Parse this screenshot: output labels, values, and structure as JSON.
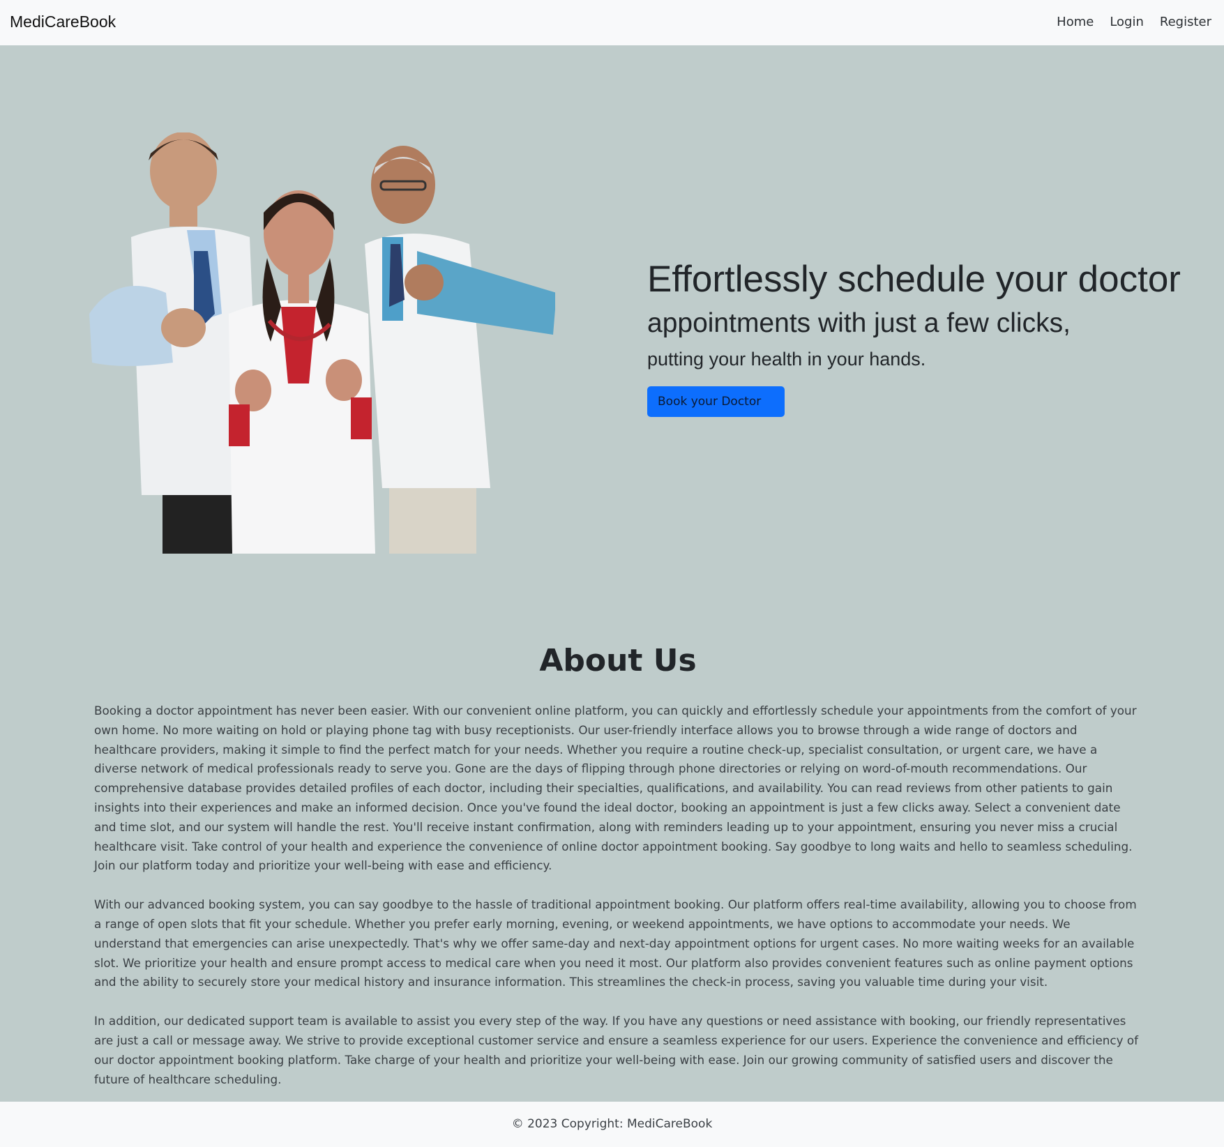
{
  "navbar": {
    "brand": "MediCareBook",
    "links": [
      "Home",
      "Login",
      "Register"
    ]
  },
  "hero": {
    "line1": "Effortlessly schedule your doctor",
    "line2": "appointments with just a few clicks,",
    "line3": "putting your health in your hands.",
    "button_label": "Book your Doctor"
  },
  "about": {
    "title": "About Us",
    "paragraphs": [
      "Booking a doctor appointment has never been easier. With our convenient online platform, you can quickly and effortlessly schedule your appointments from the comfort of your own home. No more waiting on hold or playing phone tag with busy receptionists. Our user-friendly interface allows you to browse through a wide range of doctors and healthcare providers, making it simple to find the perfect match for your needs. Whether you require a routine check-up, specialist consultation, or urgent care, we have a diverse network of medical professionals ready to serve you. Gone are the days of flipping through phone directories or relying on word-of-mouth recommendations. Our comprehensive database provides detailed profiles of each doctor, including their specialties, qualifications, and availability. You can read reviews from other patients to gain insights into their experiences and make an informed decision. Once you've found the ideal doctor, booking an appointment is just a few clicks away. Select a convenient date and time slot, and our system will handle the rest. You'll receive instant confirmation, along with reminders leading up to your appointment, ensuring you never miss a crucial healthcare visit. Take control of your health and experience the convenience of online doctor appointment booking. Say goodbye to long waits and hello to seamless scheduling. Join our platform today and prioritize your well-being with ease and efficiency.",
      "With our advanced booking system, you can say goodbye to the hassle of traditional appointment booking. Our platform offers real-time availability, allowing you to choose from a range of open slots that fit your schedule. Whether you prefer early morning, evening, or weekend appointments, we have options to accommodate your needs. We understand that emergencies can arise unexpectedly. That's why we offer same-day and next-day appointment options for urgent cases. No more waiting weeks for an available slot. We prioritize your health and ensure prompt access to medical care when you need it most. Our platform also provides convenient features such as online payment options and the ability to securely store your medical history and insurance information. This streamlines the check-in process, saving you valuable time during your visit.",
      "In addition, our dedicated support team is available to assist you every step of the way. If you have any questions or need assistance with booking, our friendly representatives are just a call or message away. We strive to provide exceptional customer service and ensure a seamless experience for our users. Experience the convenience and efficiency of our doctor appointment booking platform. Take charge of your health and prioritize your well-being with ease. Join our growing community of satisfied users and discover the future of healthcare scheduling."
    ]
  },
  "footer": {
    "text": "© 2023 Copyright: MediCareBook"
  },
  "colors": {
    "background": "#bfcccb",
    "navbar": "#f8f9fa",
    "primary_button": "#0d6efd"
  }
}
